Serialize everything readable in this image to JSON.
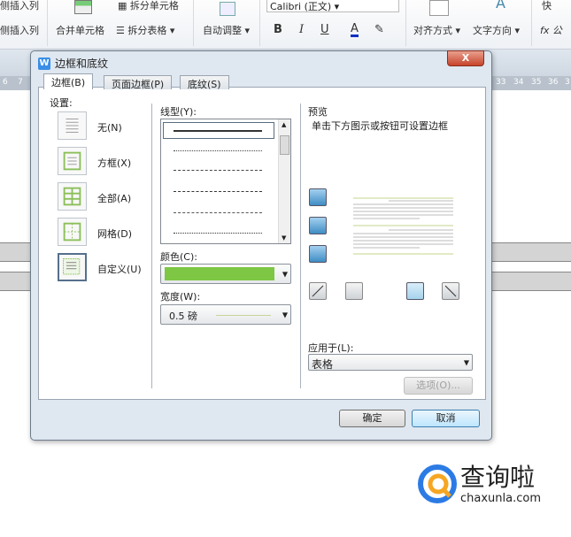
{
  "ribbon": {
    "insert_col_left": "侧插入列",
    "insert_col_right": "侧插入列",
    "merge_cells": "合并单元格",
    "split_cells": "拆分单元格",
    "split_table": "拆分表格",
    "auto_fit": "自动调整",
    "font": "Calibri (正文)",
    "bold": "B",
    "italic": "I",
    "underline": "U",
    "font_color": "A",
    "alignment": "对齐方式",
    "text_direction": "文字方向",
    "quick": "快",
    "formula": "fx 公"
  },
  "ruler": {
    "left": [
      "6",
      "7"
    ],
    "right": [
      "33",
      "34",
      "35",
      "36",
      "3"
    ]
  },
  "dialog": {
    "title": "边框和底纹",
    "close": "X",
    "tabs": [
      {
        "label": "边框(B)",
        "active": true
      },
      {
        "label": "页面边框(P)"
      },
      {
        "label": "底纹(S)"
      }
    ],
    "settings": {
      "label": "设置:",
      "items": [
        {
          "label": "无(N)",
          "icon": "none-icon"
        },
        {
          "label": "方框(X)",
          "icon": "box-icon"
        },
        {
          "label": "全部(A)",
          "icon": "all-icon"
        },
        {
          "label": "网格(D)",
          "icon": "grid-icon"
        },
        {
          "label": "自定义(U)",
          "icon": "custom-icon",
          "selected": true
        }
      ]
    },
    "line_style": {
      "label": "线型(Y):"
    },
    "color": {
      "label": "颜色(C):",
      "value": "#7dc744"
    },
    "width": {
      "label": "宽度(W):",
      "value": "0.5 磅"
    },
    "preview": {
      "label": "预览",
      "hint": "单击下方图示或按钮可设置边框"
    },
    "apply_to": {
      "label": "应用于(L):",
      "value": "表格"
    },
    "options": "选项(O)...",
    "ok": "确定",
    "cancel": "取消"
  },
  "watermark": {
    "text": "查询啦",
    "url": "chaxunla.com"
  }
}
